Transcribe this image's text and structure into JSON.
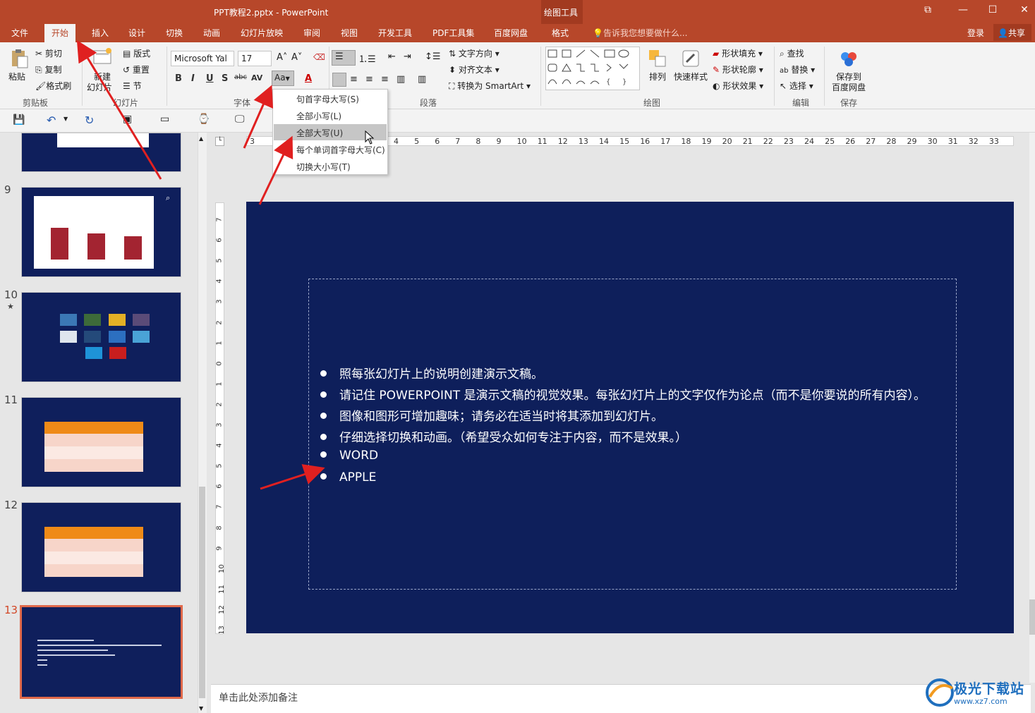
{
  "window": {
    "title": "PPT教程2.pptx - PowerPoint",
    "context_tool": "绘图工具",
    "buttons": [
      "restore-icon",
      "minimize-icon",
      "maximize-icon",
      "close-icon"
    ]
  },
  "tabs": [
    "文件",
    "开始",
    "插入",
    "设计",
    "切换",
    "动画",
    "幻灯片放映",
    "审阅",
    "视图",
    "开发工具",
    "PDF工具集",
    "百度网盘",
    "格式"
  ],
  "active_tab": "开始",
  "tell_me": "告诉我您想要做什么...",
  "login": "登录",
  "share": "共享",
  "ribbon": {
    "clipboard": {
      "paste": "粘贴",
      "cut": "剪切",
      "copy": "复制",
      "format_painter": "格式刷",
      "label": "剪贴板"
    },
    "slides": {
      "new_slide_1": "新建",
      "new_slide_2": "幻灯片",
      "layout": "版式",
      "reset": "重置",
      "section": "节",
      "label": "幻灯片"
    },
    "font": {
      "name": "Microsoft Yal",
      "size": "17",
      "bold": "B",
      "italic": "I",
      "underline": "U",
      "shadow": "S",
      "strike": "abc",
      "spacing": "AV",
      "change_case": "Aa",
      "label": "字体"
    },
    "paragraph": {
      "text_direction": "文字方向",
      "align_text": "对齐文本",
      "smartart": "转换为 SmartArt",
      "label": "段落"
    },
    "drawing": {
      "arrange": "排列",
      "quick_styles": "快速样式",
      "shape_fill": "形状填充",
      "shape_outline": "形状轮廓",
      "shape_effects": "形状效果",
      "label": "绘图"
    },
    "editing": {
      "find": "查找",
      "replace": "替换",
      "select": "选择",
      "label": "编辑"
    },
    "save": {
      "line1": "保存到",
      "line2": "百度网盘",
      "label": "保存"
    }
  },
  "change_case_menu": {
    "items": [
      "句首字母大写(S)",
      "全部小写(L)",
      "全部大写(U)",
      "每个单词首字母大写(C)",
      "切换大小写(T)"
    ],
    "hovered_index": 2
  },
  "thumbnails": [
    {
      "num": "9",
      "type": "chart"
    },
    {
      "num": "10",
      "star": "★",
      "type": "images"
    },
    {
      "num": "11",
      "type": "table"
    },
    {
      "num": "12",
      "type": "table"
    },
    {
      "num": "13",
      "type": "text",
      "selected": true
    }
  ],
  "ruler": {
    "h": [
      "3",
      "4",
      "5",
      "6",
      "7",
      "8",
      "9",
      "10",
      "11",
      "12",
      "13",
      "14",
      "15",
      "16",
      "17",
      "18",
      "19",
      "20",
      "21",
      "22",
      "23",
      "24",
      "25",
      "26",
      "27",
      "28",
      "29",
      "30",
      "31",
      "32",
      "33"
    ],
    "v": [
      "7",
      "6",
      "5",
      "4",
      "3",
      "2",
      "1",
      "0",
      "1",
      "2",
      "3",
      "4",
      "5",
      "6",
      "7",
      "8",
      "9",
      "10",
      "11",
      "12",
      "13"
    ]
  },
  "slide": {
    "bullets": [
      "照每张幻灯片上的说明创建演示文稿。",
      "请记住 POWERPOINT 是演示文稿的视觉效果。每张幻灯片上的文字仅作为论点（而不是你要说的所有内容）。",
      "图像和图形可增加趣味；请务必在适当时将其添加到幻灯片。",
      "仔细选择切换和动画。（希望受众如何专注于内容，而不是效果。）",
      "WORD",
      "APPLE"
    ]
  },
  "notes": "单击此处添加备注",
  "watermark": {
    "title": "极光下载站",
    "url": "www.xz7.com"
  },
  "colors": {
    "accent": "#b7472a",
    "slide_bg": "#0e1f5b",
    "arrow": "#e02020"
  }
}
